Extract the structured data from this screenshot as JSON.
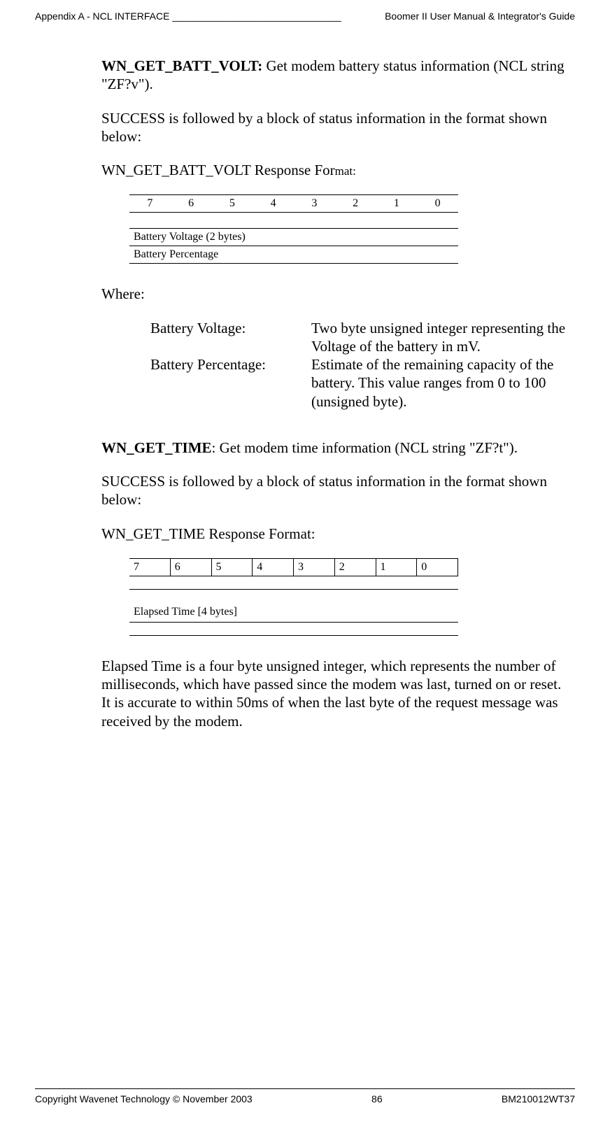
{
  "header": {
    "left": "Appendix A - NCL INTERFACE _______________________________",
    "right": "Boomer II User Manual & Integrator's Guide"
  },
  "sec1": {
    "cmd": "WN_GET_BATT_VOLT:",
    "cmdtext": "    Get modem battery status information (NCL string \"ZF?v\").",
    "p1": "SUCCESS is followed by a block of status information in the format shown below:",
    "p2a": "WN_GET_BATT_VOLT Response For",
    "p2b": "mat:",
    "bits": [
      "7",
      "6",
      "5",
      "4",
      "3",
      "2",
      "1",
      "0"
    ],
    "row_bv": "Battery Voltage (2 bytes)",
    "row_bp": "Battery Percentage",
    "where": "Where:",
    "d1_label": "Battery Voltage:",
    "d1_text": "Two byte unsigned integer representing the Voltage of the battery in mV.",
    "d2_label": "Battery Percentage:",
    "d2_text": "Estimate of the remaining capacity of the battery.  This value ranges from 0 to 100 (unsigned byte)."
  },
  "sec2": {
    "cmd": "WN_GET_TIME",
    "cmdtext": ":     Get modem time information (NCL string \"ZF?t\").",
    "p1": "SUCCESS is followed by a block of status information in the format shown below:",
    "p2": "WN_GET_TIME Response Format:",
    "bits": [
      "7",
      "6",
      "5",
      "4",
      "3",
      "2",
      "1",
      "0"
    ],
    "row_et": "Elapsed Time [4 bytes]",
    "p3": "Elapsed Time is a four byte unsigned integer, which represents the number of milliseconds, which have passed since the modem was last, turned on or reset.  It is accurate to within 50ms of when the last byte of the request message was received by the modem."
  },
  "footer": {
    "left": "Copyright Wavenet Technology © November 2003",
    "center": "86",
    "right": "BM210012WT37"
  }
}
